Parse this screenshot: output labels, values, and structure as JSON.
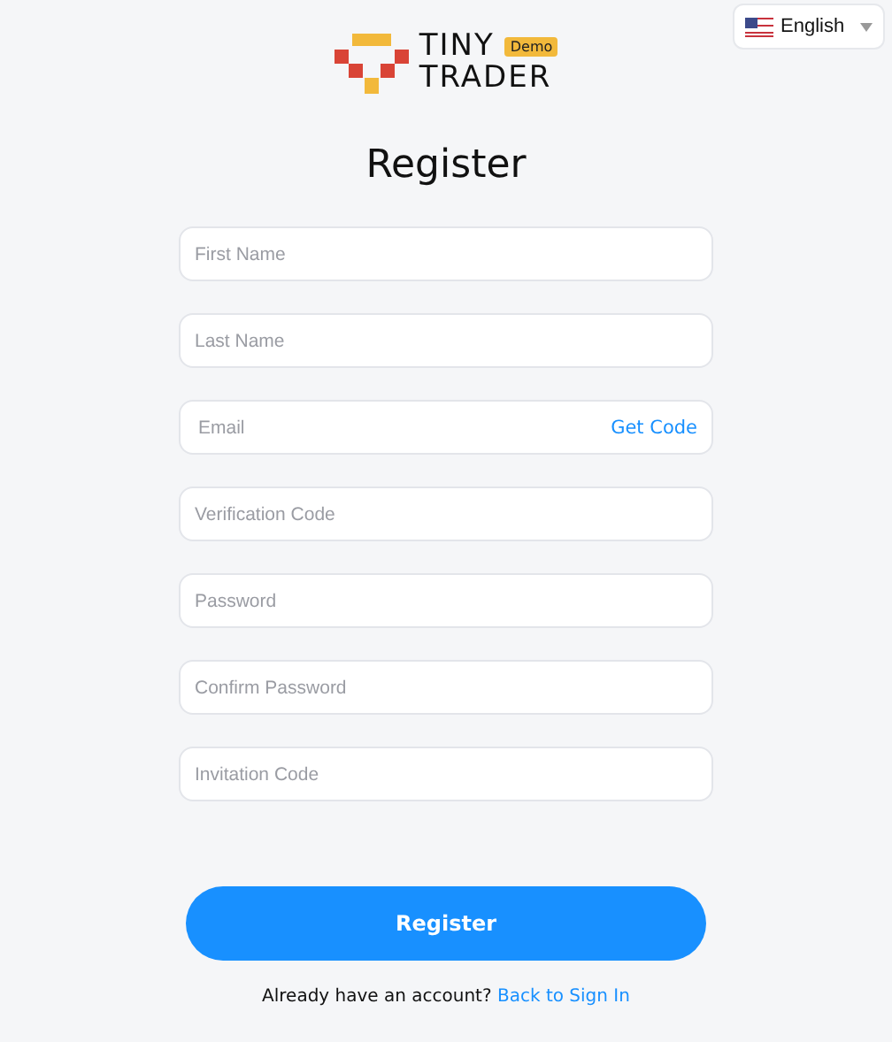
{
  "language": {
    "label": "English"
  },
  "logo": {
    "line_1": "TINY",
    "line_2": "TRADER",
    "badge": "Demo"
  },
  "title": "Register",
  "fields": [
    {
      "placeholder": "First Name"
    },
    {
      "placeholder": "Last Name"
    },
    {
      "placeholder": "Email",
      "action": "Get Code"
    },
    {
      "placeholder": "Verification Code"
    },
    {
      "placeholder": "Password"
    },
    {
      "placeholder": "Confirm Password"
    },
    {
      "placeholder": "Invitation Code"
    }
  ],
  "submit": "Register",
  "footer": {
    "text": "Already have an account?",
    "link": "Back to Sign In"
  }
}
